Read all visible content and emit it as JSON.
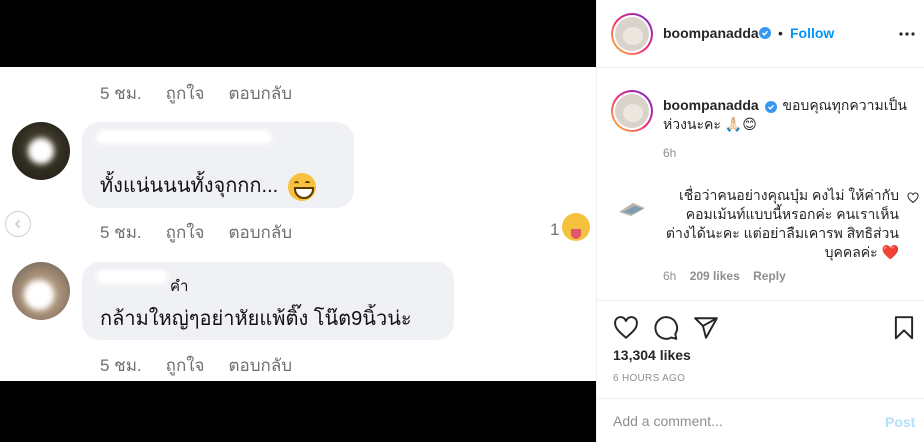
{
  "media": {
    "comments": [
      {
        "time": "5 ชม.",
        "like": "ถูกใจ",
        "reply": "ตอบกลับ"
      },
      {
        "text": "ทั้งแน่นนนทั้งจุกกก...",
        "emoji": "grinning-face-emoji",
        "time": "5 ชม.",
        "like": "ถูกใจ",
        "reply": "ตอบกลับ",
        "reaction_count": "1"
      },
      {
        "name_suffix": "คำ",
        "text": "กล้ามใหญ่ๆอย่าหัยแพ้ติ๊ง โน๊ต9นิ้วน่ะ",
        "time": "5 ชม.",
        "like": "ถูกใจ",
        "reply": "ตอบกลับ"
      }
    ]
  },
  "header": {
    "username": "boompanadda",
    "separator": "•",
    "follow_label": "Follow",
    "more_icon": "more-horizontal-icon"
  },
  "caption": {
    "username": "boompanadda",
    "text": "ขอบคุณทุกความเป็นห่วงนะคะ 🙏🏻😊",
    "time": "6h"
  },
  "comment": {
    "text": "เชื่อว่าคนอย่างคุณบุ๋ม คงไม่ ให้ค่ากับคอมเม้นท์แบบนี้หรอกค่ะ คนเราเห็นต่างได้นะคะ แต่อย่าลืมเคารพ สิทธิส่วนบุคคลค่ะ ❤️",
    "time": "6h",
    "likes": "209 likes",
    "reply": "Reply"
  },
  "actions": {
    "likes": "13,304 likes",
    "ago": "6 HOURS AGO"
  },
  "add_comment": {
    "placeholder": "Add a comment...",
    "post_label": "Post"
  },
  "colors": {
    "link_blue": "#0095f6",
    "verified_blue": "#3897f0",
    "post_disabled": "#b2dffc",
    "heart_red": "#ed4956"
  }
}
